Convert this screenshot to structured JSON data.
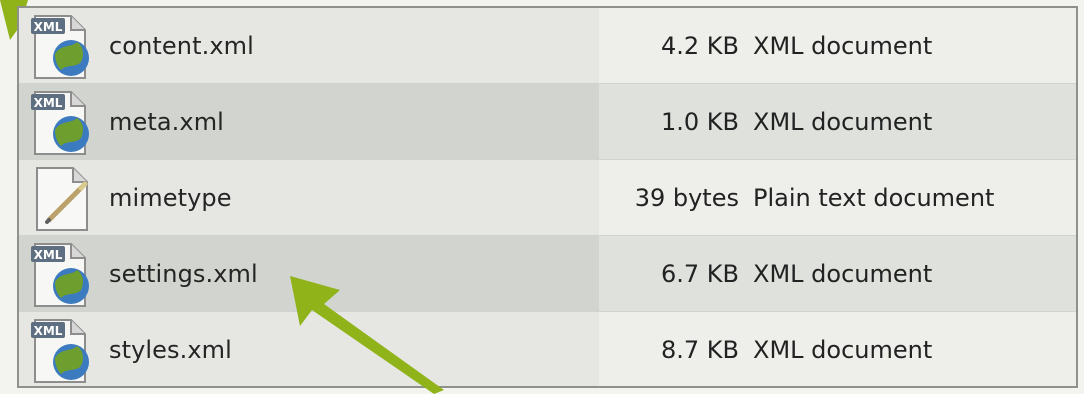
{
  "files": [
    {
      "name": "content.xml",
      "size": "4.2 KB",
      "type": "XML document",
      "icon": "xml-file-icon"
    },
    {
      "name": "meta.xml",
      "size": "1.0 KB",
      "type": "XML document",
      "icon": "xml-file-icon"
    },
    {
      "name": "mimetype",
      "size": "39 bytes",
      "type": "Plain text document",
      "icon": "text-file-icon"
    },
    {
      "name": "settings.xml",
      "size": "6.7 KB",
      "type": "XML document",
      "icon": "xml-file-icon"
    },
    {
      "name": "styles.xml",
      "size": "8.7 KB",
      "type": "XML document",
      "icon": "xml-file-icon"
    }
  ],
  "icon_badge_text": "XML",
  "colors": {
    "arrow": "#8fb318",
    "border": "#8f918c",
    "row_alt": "#dfe1dc"
  }
}
